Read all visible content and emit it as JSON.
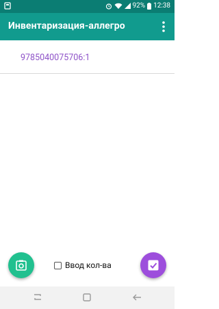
{
  "status_bar": {
    "battery": "92%",
    "time": "12:38"
  },
  "app_bar": {
    "title": "Инвентаризация-аллегро"
  },
  "list": {
    "items": [
      "9785040075706:1"
    ]
  },
  "bottom": {
    "checkbox_label": "Ввод кол-ва",
    "checkbox_checked": false
  },
  "colors": {
    "status_bar": "#0b7d73",
    "app_bar": "#119b8e",
    "list_text": "#8e52c8",
    "fab_left": "#21c08f",
    "fab_right": "#9d4edc"
  },
  "icons": {
    "fab_left": "camera-icon",
    "fab_right": "check-icon",
    "menu": "more-vert-icon"
  }
}
